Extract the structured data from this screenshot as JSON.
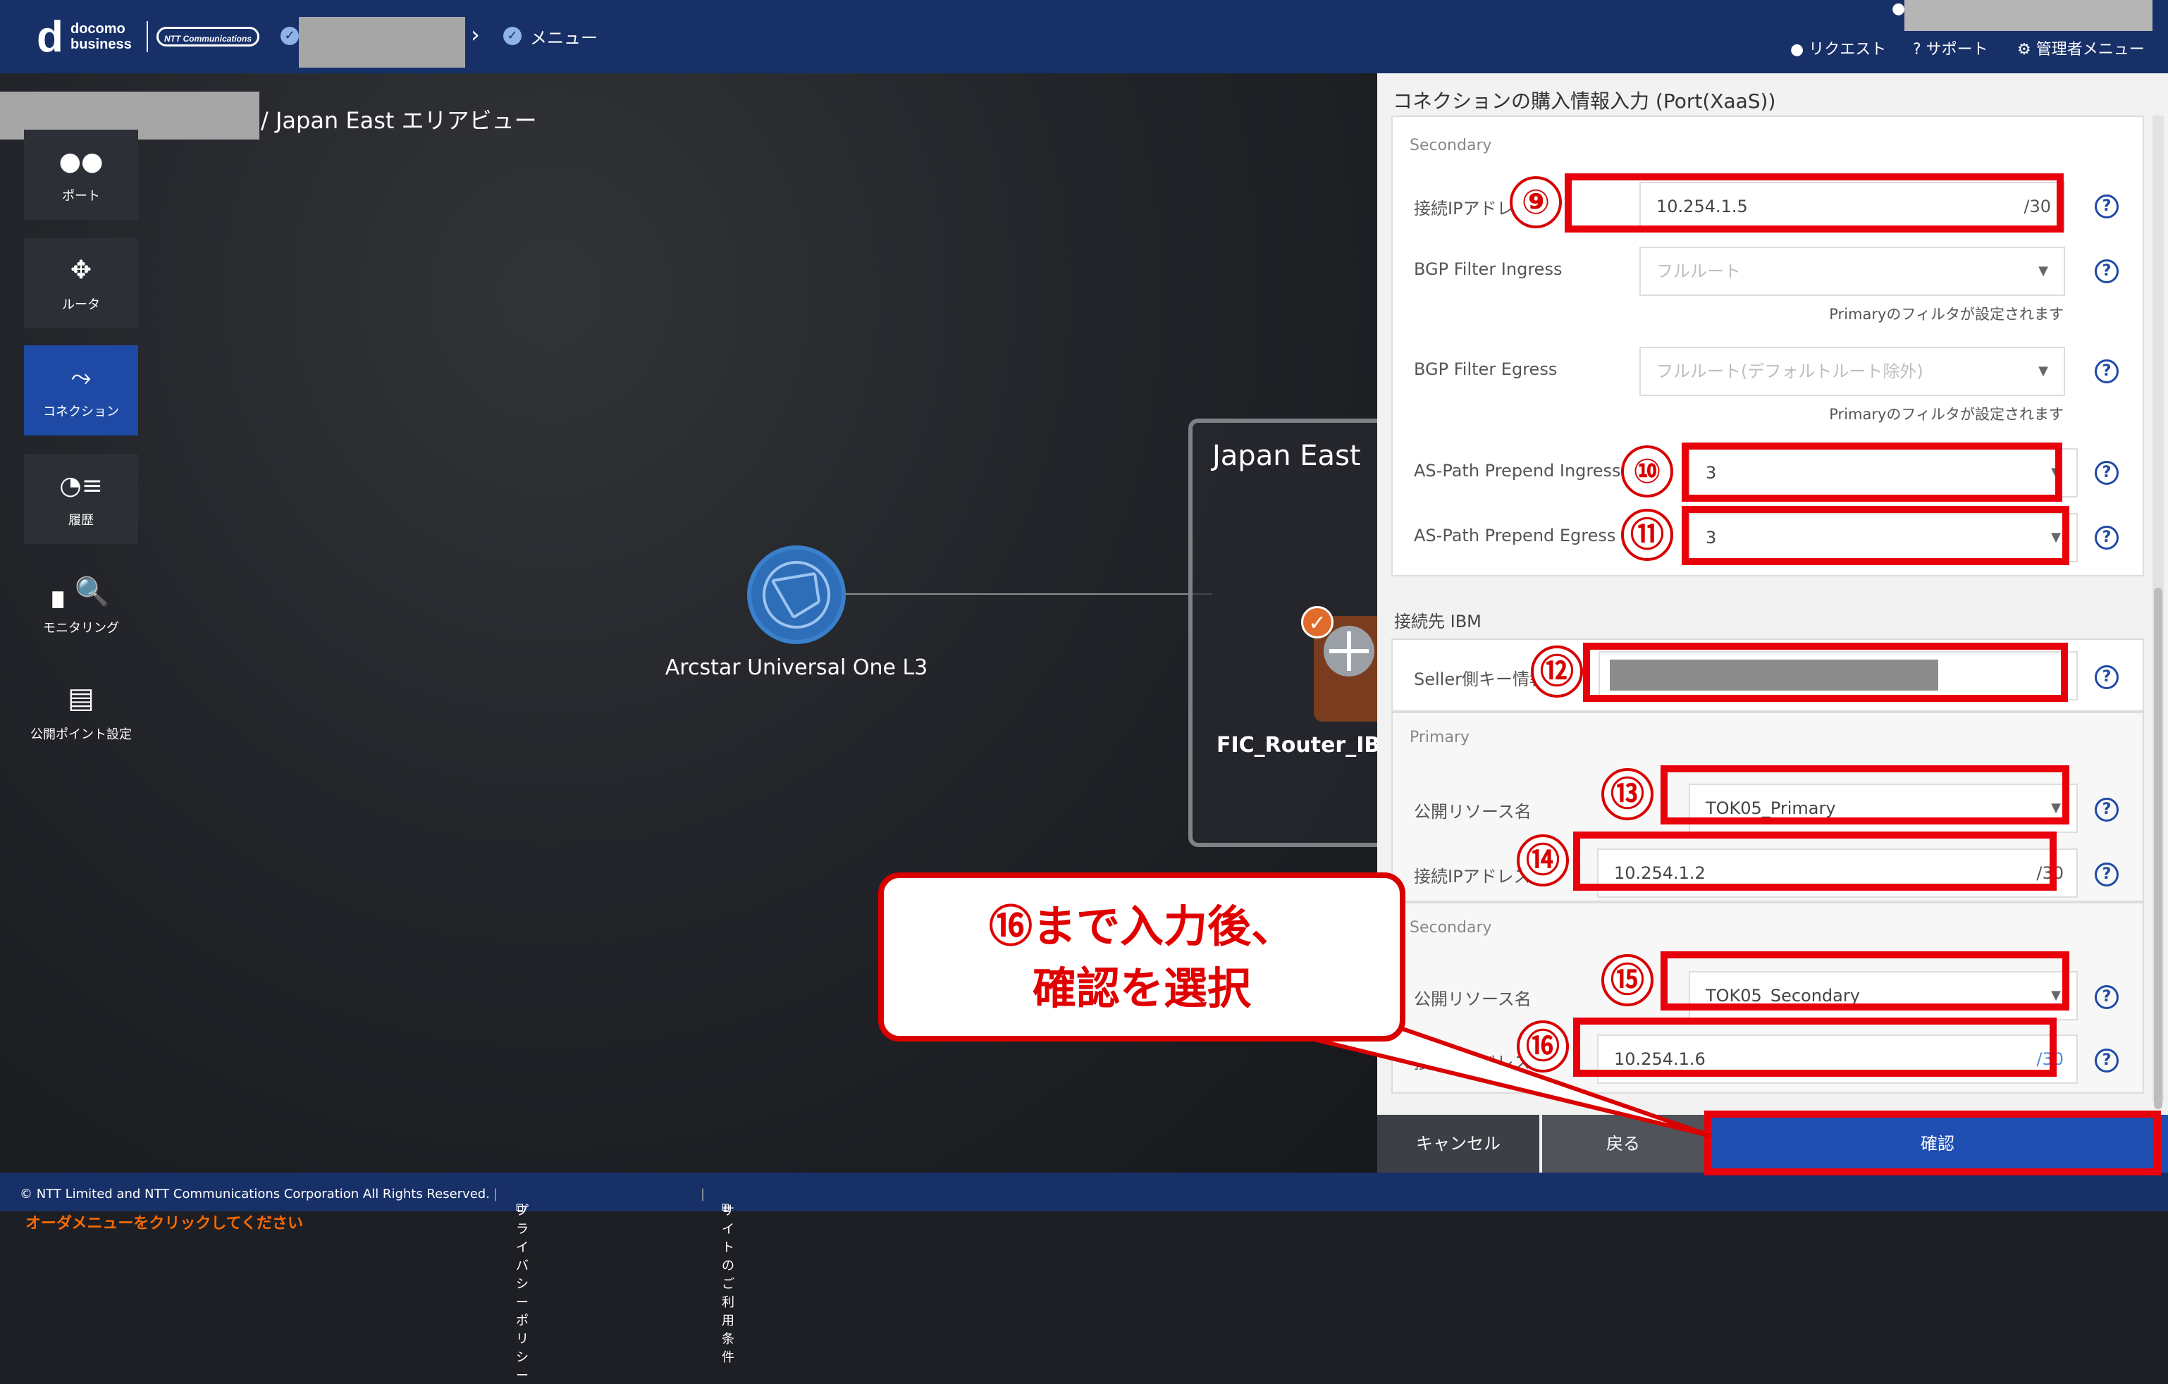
{
  "header": {
    "logo_top": "docomo",
    "logo_bottom": "business",
    "ntt_logo": "NTT Communications",
    "breadcrumb_menu": "メニュー",
    "links": {
      "request": "リクエスト",
      "support": "サポート",
      "admin": "管理者メニュー"
    },
    "icons": {
      "breadcrumb": "check-circle-icon",
      "user": "user-icon",
      "request": "user-icon",
      "support": "question-circle-icon",
      "admin": "gear-icon"
    }
  },
  "canvas": {
    "area_title": "/ Japan East エリアビュー",
    "sidebar": [
      {
        "label": "ポート",
        "icon": "port-icon"
      },
      {
        "label": "ルータ",
        "icon": "router-icon"
      },
      {
        "label": "コネクション",
        "icon": "connection-icon"
      },
      {
        "label": "履歴",
        "icon": "history-icon"
      },
      {
        "label": "モニタリング",
        "icon": "monitoring-icon"
      },
      {
        "label": "公開ポイント設定",
        "icon": "public-point-icon"
      }
    ],
    "node_label": "Arcstar Universal One L3",
    "region_title": "Japan East",
    "router_label": "FIC_Router_IB",
    "order_hint": "オーダメニューをクリックしてください"
  },
  "panel": {
    "title": "コネクションの購入情報入力 (Port(XaaS))",
    "secondary_label": "Secondary",
    "ip_label": "接続IPアドレス",
    "ip_value": "10.254.1.5",
    "ip_suffix": "/30",
    "bgp_ingress_label": "BGP Filter Ingress",
    "bgp_ingress_value": "フルルート",
    "bgp_egress_label": "BGP Filter Egress",
    "bgp_egress_value": "フルルート(デフォルトルート除外)",
    "filter_note": "Primaryのフィルタが設定されます",
    "as_ingress_label": "AS-Path Prepend Ingress",
    "as_ingress_value": "3",
    "as_egress_label": "AS-Path Prepend Egress",
    "as_egress_value": "3",
    "dest_label": "接続先 IBM",
    "seller_key_label": "Seller側キー情報",
    "primary_label": "Primary",
    "resource_label": "公開リソース名",
    "primary_resource": "TOK05_Primary",
    "primary_ip": "10.254.1.2",
    "secondary_resource": "TOK05_Secondary",
    "secondary_ip": "10.254.1.6",
    "help_glyph": "?",
    "arrow_glyph": "▼",
    "buttons": {
      "cancel": "キャンセル",
      "back": "戻る",
      "confirm": "確認"
    },
    "colors": {
      "cancel": "#3c3f45",
      "back": "#50535a",
      "confirm": "#1f4fb3"
    }
  },
  "annotations": {
    "numbers": [
      "⑨",
      "⑩",
      "⑪",
      "⑫",
      "⑬",
      "⑭",
      "⑮",
      "⑯"
    ],
    "callout_line1": "⑯まで入力後、",
    "callout_line2": "確認を選択"
  },
  "footer": {
    "copyright": "© NTT Limited and NTT Communications Corporation All Rights Reserved.",
    "privacy": "プライバシーポリシー",
    "terms": "サイトのご利用条件"
  }
}
